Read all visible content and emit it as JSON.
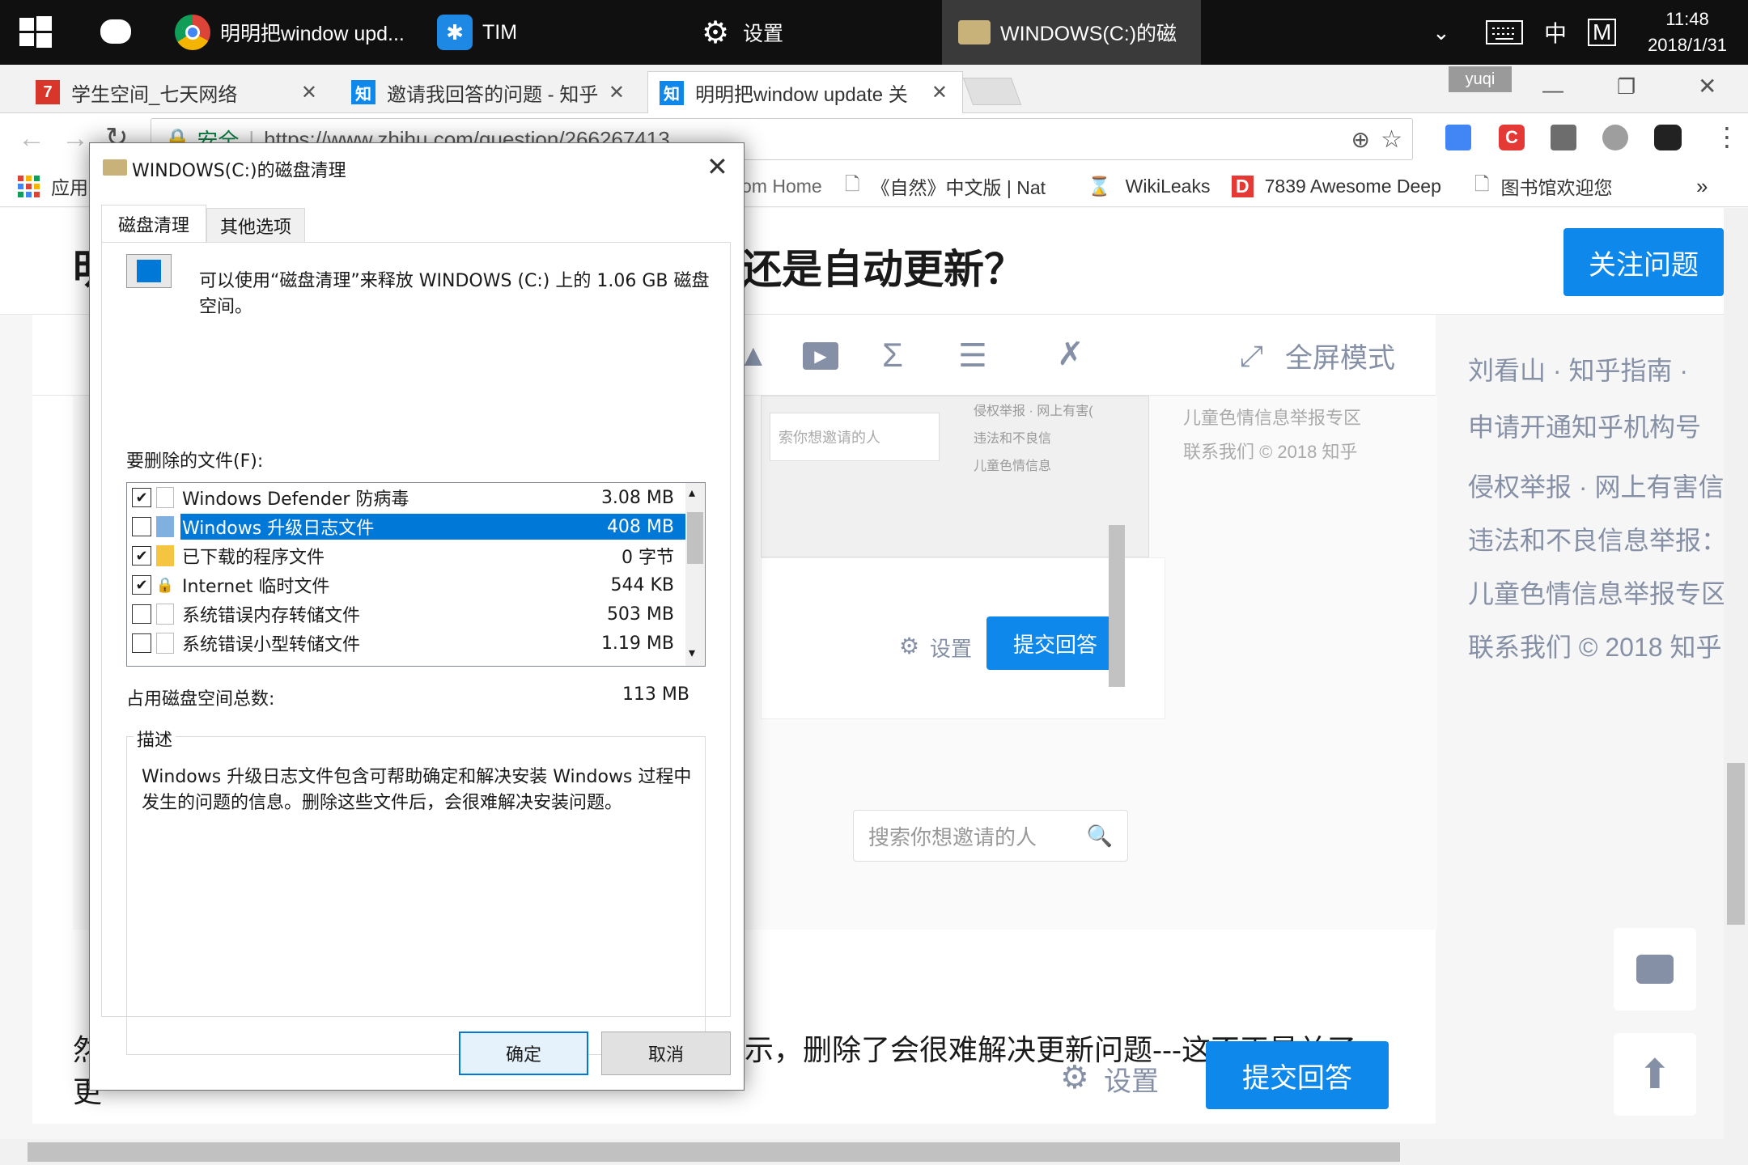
{
  "taskbar": {
    "apps": [
      {
        "label": "明明把window upd...",
        "icon": "chrome-icon"
      },
      {
        "label": "TIM",
        "icon": "tim-icon"
      },
      {
        "label": "设置",
        "icon": "gear-icon"
      },
      {
        "label": "WINDOWS(C:)的磁",
        "icon": "disk-cleanup-icon"
      }
    ],
    "ime": "中",
    "ime_mode": "M",
    "time": "11:48",
    "date": "2018/1/31"
  },
  "browser": {
    "tabs": [
      {
        "favicon": "7",
        "label": "学生空间_七天网络",
        "color": "#d9362b"
      },
      {
        "favicon": "知",
        "label": "邀请我回答的问题 - 知乎",
        "color": "#0f88eb"
      },
      {
        "favicon": "知",
        "label": "明明把window update 关",
        "color": "#0f88eb"
      }
    ],
    "profile": "yuqi",
    "secure_label": "安全",
    "url": "https://www.zhihu.com/question/266267413",
    "bookmarks": [
      "应用",
      "om Home",
      "《自然》中文版 | Nat",
      "WikiLeaks",
      "7839 Awesome Deep",
      "图书馆欢迎您"
    ],
    "bookmarks_more": "»"
  },
  "page": {
    "title_start": "明",
    "title_end": "还是自动更新？",
    "follow_button": "关注问题",
    "editor_fullscreen": "全屏模式",
    "body_text": "示，删除了会很难解决更新问题---这不正是关了",
    "body_prefix1": "然",
    "body_prefix2": "更",
    "settings_label": "设置",
    "submit_label": "提交回答",
    "embedded": {
      "settings_label": "设置",
      "submit_label": "提交回答",
      "search_placeholder": "搜索你想邀请的人",
      "small_search": "索你想邀请的人",
      "small_links": [
        "侵权举报 · 网上有害(",
        "违法和不良信",
        "儿童色情信息"
      ],
      "right_links": [
        "儿童色情信息举报专区",
        "联系我们 © 2018 知乎"
      ]
    },
    "sidebar_links": [
      "刘看山 · 知乎指南 · ",
      "申请开通知乎机构号",
      "侵权举报 · 网上有害信",
      "违法和不良信息举报：",
      "儿童色情信息举报专区",
      "联系我们 © 2018 知乎"
    ]
  },
  "dialog": {
    "title": "WINDOWS(C:)的磁盘清理",
    "tabs": [
      "磁盘清理",
      "其他选项"
    ],
    "intro": "可以使用“磁盘清理”来释放 WINDOWS (C:) 上的 1.06 GB 磁盘空间。",
    "files_label": "要删除的文件(F):",
    "files": [
      {
        "checked": true,
        "name": "Windows Defender 防病毒",
        "size": "3.08 MB",
        "icon": "file-icon",
        "selected": false
      },
      {
        "checked": false,
        "name": "Windows 升级日志文件",
        "size": "408 MB",
        "icon": "log-file-icon",
        "selected": true
      },
      {
        "checked": true,
        "name": "已下载的程序文件",
        "size": "0 字节",
        "icon": "folder-icon",
        "selected": false
      },
      {
        "checked": true,
        "name": "Internet 临时文件",
        "size": "544 KB",
        "icon": "lock-icon",
        "selected": false
      },
      {
        "checked": false,
        "name": "系统错误内存转储文件",
        "size": "503 MB",
        "icon": "file-icon",
        "selected": false
      },
      {
        "checked": false,
        "name": "系统错误小型转储文件",
        "size": "1.19 MB",
        "icon": "file-icon",
        "selected": false
      }
    ],
    "total_label": "占用磁盘空间总数:",
    "total_value": "113 MB",
    "desc_label": "描述",
    "description": "Windows 升级日志文件包含可帮助确定和解决安装 Windows 过程中发生的问题的信息。删除这些文件后，会很难解决安装问题。",
    "ok": "确定",
    "cancel": "取消"
  },
  "colors": {
    "accent": "#0f88eb",
    "selection": "#0078d7",
    "taskbar": "#101010"
  }
}
